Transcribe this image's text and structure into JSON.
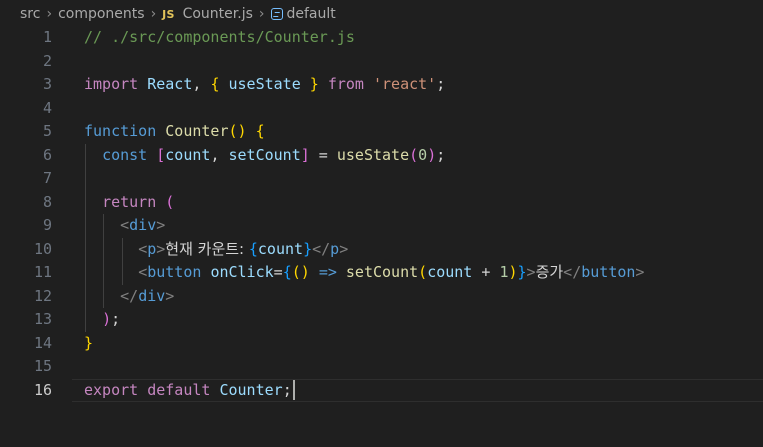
{
  "breadcrumb": {
    "items": [
      "src",
      "components",
      "Counter.js",
      "default"
    ],
    "file_type_badge": "JS"
  },
  "code": {
    "current_line": 16,
    "lines": [
      {
        "num": "1",
        "tokens": [
          [
            "// ./src/components/Counter.js",
            "c"
          ]
        ]
      },
      {
        "num": "2",
        "tokens": []
      },
      {
        "num": "3",
        "tokens": [
          [
            "import",
            "kw"
          ],
          [
            " ",
            "p"
          ],
          [
            "React",
            "v"
          ],
          [
            ", ",
            "p"
          ],
          [
            "{",
            "b1"
          ],
          [
            " ",
            "p"
          ],
          [
            "useState",
            "v"
          ],
          [
            " ",
            "p"
          ],
          [
            "}",
            "b1"
          ],
          [
            " ",
            "p"
          ],
          [
            "from",
            "kw"
          ],
          [
            " ",
            "p"
          ],
          [
            "'react'",
            "s"
          ],
          [
            ";",
            "p"
          ]
        ]
      },
      {
        "num": "4",
        "tokens": []
      },
      {
        "num": "5",
        "tokens": [
          [
            "function",
            "st"
          ],
          [
            " ",
            "p"
          ],
          [
            "Counter",
            "fn"
          ],
          [
            "()",
            "b1"
          ],
          [
            " ",
            "p"
          ],
          [
            "{",
            "b1"
          ]
        ]
      },
      {
        "num": "6",
        "tokens": [
          [
            "  ",
            "p"
          ],
          [
            "const",
            "st"
          ],
          [
            " ",
            "p"
          ],
          [
            "[",
            "b2"
          ],
          [
            "count",
            "v"
          ],
          [
            ", ",
            "p"
          ],
          [
            "setCount",
            "v"
          ],
          [
            "]",
            "b2"
          ],
          [
            " = ",
            "p"
          ],
          [
            "useState",
            "fn"
          ],
          [
            "(",
            "b2"
          ],
          [
            "0",
            "n"
          ],
          [
            ")",
            "b2"
          ],
          [
            ";",
            "p"
          ]
        ]
      },
      {
        "num": "7",
        "tokens": []
      },
      {
        "num": "8",
        "tokens": [
          [
            "  ",
            "p"
          ],
          [
            "return",
            "kw"
          ],
          [
            " ",
            "p"
          ],
          [
            "(",
            "b2"
          ]
        ]
      },
      {
        "num": "9",
        "tokens": [
          [
            "    ",
            "p"
          ],
          [
            "<",
            "ab"
          ],
          [
            "div",
            "tg"
          ],
          [
            ">",
            "ab"
          ]
        ]
      },
      {
        "num": "10",
        "tokens": [
          [
            "      ",
            "p"
          ],
          [
            "<",
            "ab"
          ],
          [
            "p",
            "tg"
          ],
          [
            ">",
            "ab"
          ],
          [
            "현재 카운트: ",
            "tx ko"
          ],
          [
            "{",
            "b3"
          ],
          [
            "count",
            "v"
          ],
          [
            "}",
            "b3"
          ],
          [
            "</",
            "ab"
          ],
          [
            "p",
            "tg"
          ],
          [
            ">",
            "ab"
          ]
        ]
      },
      {
        "num": "11",
        "tokens": [
          [
            "      ",
            "p"
          ],
          [
            "<",
            "ab"
          ],
          [
            "button",
            "tg"
          ],
          [
            " ",
            "p"
          ],
          [
            "onClick",
            "v"
          ],
          [
            "=",
            "p"
          ],
          [
            "{",
            "b3"
          ],
          [
            "()",
            "b1"
          ],
          [
            " ",
            "p"
          ],
          [
            "=>",
            "st"
          ],
          [
            " ",
            "p"
          ],
          [
            "setCount",
            "fn"
          ],
          [
            "(",
            "b1"
          ],
          [
            "count",
            "v"
          ],
          [
            " + ",
            "p"
          ],
          [
            "1",
            "n"
          ],
          [
            ")",
            "b1"
          ],
          [
            "}",
            "b3"
          ],
          [
            ">",
            "ab"
          ],
          [
            "증가",
            "tx ko"
          ],
          [
            "</",
            "ab"
          ],
          [
            "button",
            "tg"
          ],
          [
            ">",
            "ab"
          ]
        ]
      },
      {
        "num": "12",
        "tokens": [
          [
            "    ",
            "p"
          ],
          [
            "</",
            "ab"
          ],
          [
            "div",
            "tg"
          ],
          [
            ">",
            "ab"
          ]
        ]
      },
      {
        "num": "13",
        "tokens": [
          [
            "  ",
            "p"
          ],
          [
            ")",
            "b2"
          ],
          [
            ";",
            "p"
          ]
        ]
      },
      {
        "num": "14",
        "tokens": [
          [
            "}",
            "b1"
          ]
        ]
      },
      {
        "num": "15",
        "tokens": []
      },
      {
        "num": "16",
        "tokens": [
          [
            "export",
            "kw"
          ],
          [
            " ",
            "p"
          ],
          [
            "default",
            "kw"
          ],
          [
            " ",
            "p"
          ],
          [
            "Counter",
            "v"
          ],
          [
            ";",
            "p"
          ]
        ]
      }
    ]
  }
}
